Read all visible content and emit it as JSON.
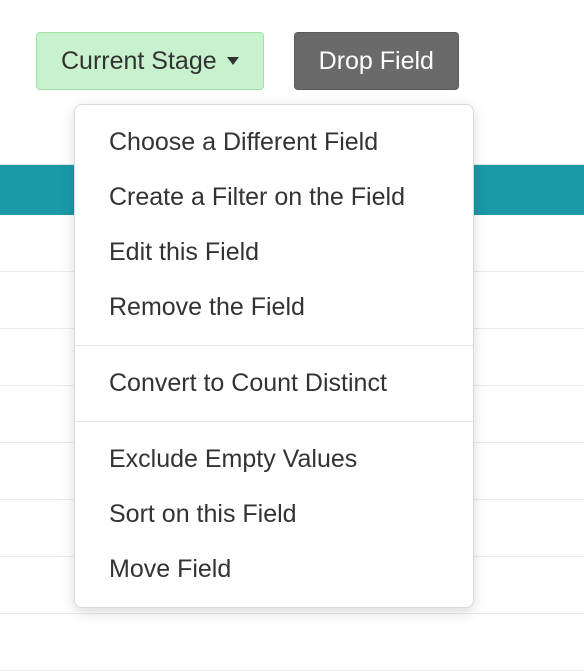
{
  "toolbar": {
    "current_stage_label": "Current Stage",
    "drop_field_label": "Drop Field"
  },
  "menu": {
    "group1": [
      "Choose a Different Field",
      "Create a Filter on the Field",
      "Edit this Field",
      "Remove the Field"
    ],
    "group2": [
      "Convert to Count Distinct"
    ],
    "group3": [
      "Exclude Empty Values",
      "Sort on this Field",
      "Move Field"
    ]
  }
}
